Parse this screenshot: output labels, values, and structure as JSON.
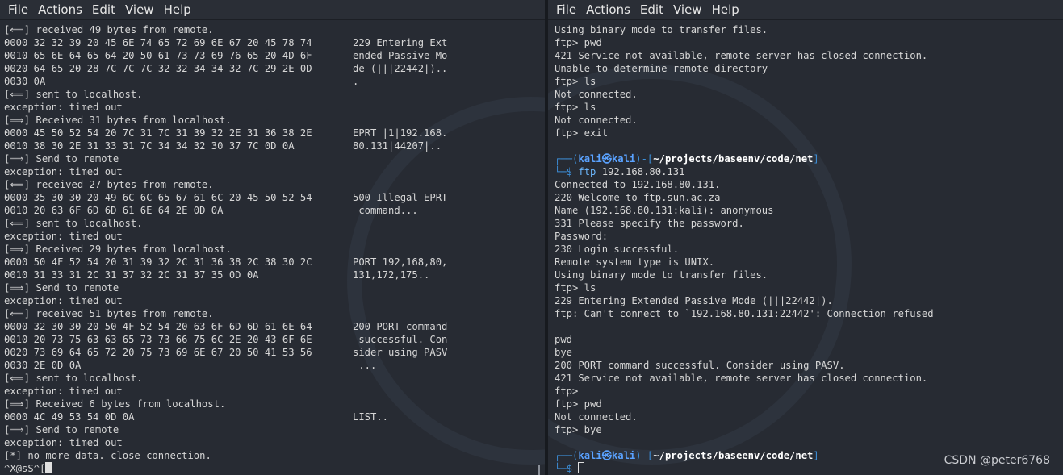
{
  "left_terminal": {
    "menu": [
      "File",
      "Actions",
      "Edit",
      "View",
      "Help"
    ],
    "lines": [
      {
        "t": "[⟸] received 49 bytes from remote."
      },
      {
        "hex": "0000 32 32 39 20 45 6E 74 65 72 69 6E 67 20 45 78 74",
        "ascii": "229 Entering Ext"
      },
      {
        "hex": "0010 65 6E 64 65 64 20 50 61 73 73 69 76 65 20 4D 6F",
        "ascii": "ended Passive Mo"
      },
      {
        "hex": "0020 64 65 20 28 7C 7C 7C 32 32 34 34 32 7C 29 2E 0D",
        "ascii": "de (|||22442|).."
      },
      {
        "hex": "0030 0A",
        "ascii": "."
      },
      {
        "t": "[⟸] sent to localhost."
      },
      {
        "t": "exception: timed out"
      },
      {
        "t": "[⟹] Received 31 bytes from localhost."
      },
      {
        "hex": "0000 45 50 52 54 20 7C 31 7C 31 39 32 2E 31 36 38 2E",
        "ascii": "EPRT |1|192.168."
      },
      {
        "hex": "0010 38 30 2E 31 33 31 7C 34 34 32 30 37 7C 0D 0A",
        "ascii": "80.131|44207|.."
      },
      {
        "t": "[⟹] Send to remote"
      },
      {
        "t": "exception: timed out"
      },
      {
        "t": "[⟸] received 27 bytes from remote."
      },
      {
        "hex": "0000 35 30 30 20 49 6C 6C 65 67 61 6C 20 45 50 52 54",
        "ascii": "500 Illegal EPRT"
      },
      {
        "hex": "0010 20 63 6F 6D 6D 61 6E 64 2E 0D 0A",
        "ascii": " command..."
      },
      {
        "t": "[⟸] sent to localhost."
      },
      {
        "t": "exception: timed out"
      },
      {
        "t": "[⟹] Received 29 bytes from localhost."
      },
      {
        "hex": "0000 50 4F 52 54 20 31 39 32 2C 31 36 38 2C 38 30 2C",
        "ascii": "PORT 192,168,80,"
      },
      {
        "hex": "0010 31 33 31 2C 31 37 32 2C 31 37 35 0D 0A",
        "ascii": "131,172,175.."
      },
      {
        "t": "[⟹] Send to remote"
      },
      {
        "t": "exception: timed out"
      },
      {
        "t": "[⟸] received 51 bytes from remote."
      },
      {
        "hex": "0000 32 30 30 20 50 4F 52 54 20 63 6F 6D 6D 61 6E 64",
        "ascii": "200 PORT command"
      },
      {
        "hex": "0010 20 73 75 63 63 65 73 73 66 75 6C 2E 20 43 6F 6E",
        "ascii": " successful. Con"
      },
      {
        "hex": "0020 73 69 64 65 72 20 75 73 69 6E 67 20 50 41 53 56",
        "ascii": "sider using PASV"
      },
      {
        "hex": "0030 2E 0D 0A",
        "ascii": " ..."
      },
      {
        "t": "[⟸] sent to localhost."
      },
      {
        "t": "exception: timed out"
      },
      {
        "t": "[⟹] Received 6 bytes from localhost."
      },
      {
        "hex": "0000 4C 49 53 54 0D 0A",
        "ascii": "LIST.."
      },
      {
        "t": "[⟹] Send to remote"
      },
      {
        "t": "exception: timed out"
      },
      {
        "t": "[*] no more data. close connection."
      },
      {
        "t": "^X@sS^[",
        "cursor": true
      }
    ]
  },
  "right_terminal": {
    "menu": [
      "File",
      "Actions",
      "Edit",
      "View",
      "Help"
    ],
    "lines": [
      {
        "t": "Using binary mode to transfer files."
      },
      {
        "t": "ftp> pwd"
      },
      {
        "t": "421 Service not available, remote server has closed connection."
      },
      {
        "t": "Unable to determine remote directory"
      },
      {
        "t": "ftp> ls"
      },
      {
        "t": "Not connected."
      },
      {
        "t": "ftp> ls"
      },
      {
        "t": "Not connected."
      },
      {
        "t": "ftp> exit"
      },
      {
        "t": ""
      },
      {
        "prompt": {
          "user": "kali㉿kali",
          "path": "~/projects/baseenv/code/net"
        }
      },
      {
        "cmd": {
          "name": "ftp",
          "args": " 192.168.80.131"
        }
      },
      {
        "t": "Connected to 192.168.80.131."
      },
      {
        "t": "220 Welcome to ftp.sun.ac.za"
      },
      {
        "t": "Name (192.168.80.131:kali): anonymous"
      },
      {
        "t": "331 Please specify the password."
      },
      {
        "t": "Password:"
      },
      {
        "t": "230 Login successful."
      },
      {
        "t": "Remote system type is UNIX."
      },
      {
        "t": "Using binary mode to transfer files."
      },
      {
        "t": "ftp> ls"
      },
      {
        "t": "229 Entering Extended Passive Mode (|||22442|)."
      },
      {
        "t": "ftp: Can't connect to `192.168.80.131:22442': Connection refused"
      },
      {
        "t": ""
      },
      {
        "t": "pwd"
      },
      {
        "t": "bye"
      },
      {
        "t": "200 PORT command successful. Consider using PASV."
      },
      {
        "t": "421 Service not available, remote server has closed connection."
      },
      {
        "t": "ftp>"
      },
      {
        "t": "ftp> pwd"
      },
      {
        "t": "Not connected."
      },
      {
        "t": "ftp> bye"
      },
      {
        "t": ""
      },
      {
        "prompt": {
          "user": "kali㉿kali",
          "path": "~/projects/baseenv/code/net"
        }
      },
      {
        "cursor_line": true
      }
    ]
  },
  "watermark": "CSDN @peter6768",
  "prompt_glyphs": {
    "top_open": "┌──(",
    "top_close": ")-[",
    "path_close": "]",
    "bottom": "└─$ "
  }
}
